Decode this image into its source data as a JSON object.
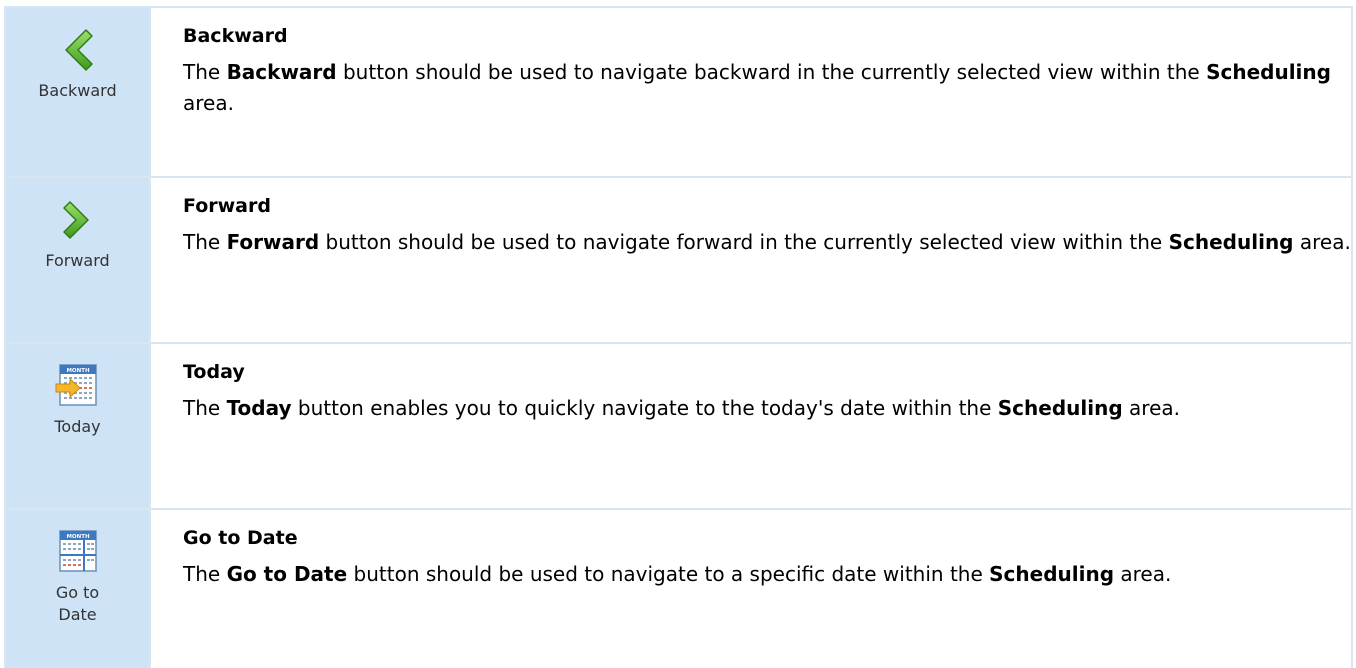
{
  "rows": [
    {
      "button_label": "Backward",
      "icon": "chevron-left-icon",
      "title": "Backward",
      "text_1": "The ",
      "bold_1": "Backward",
      "text_2": " button should be used to navigate backward in the currently selected view within the ",
      "bold_2": "Scheduling",
      "text_3": " area."
    },
    {
      "button_label": "Forward",
      "icon": "chevron-right-icon",
      "title": "Forward",
      "text_1": "The ",
      "bold_1": "Forward",
      "text_2": " button should be used to navigate forward in the currently selected view within the ",
      "bold_2": "Scheduling",
      "text_3": " area."
    },
    {
      "button_label": "Today",
      "icon": "calendar-today-icon",
      "calendar_header": "MONTH",
      "title": "Today",
      "text_1": "The ",
      "bold_1": "Today",
      "text_2": " button enables you to quickly navigate to the today's date within the ",
      "bold_2": "Scheduling",
      "text_3": " area."
    },
    {
      "button_label_line1": "Go to",
      "button_label_line2": "Date",
      "icon": "calendar-goto-icon",
      "calendar_header": "MONTH",
      "title": "Go to Date",
      "text_1": "The ",
      "bold_1": "Go to Date",
      "text_2": " button should be used to navigate to a specific date within the ",
      "bold_2": "Scheduling",
      "text_3": " area."
    }
  ],
  "colors": {
    "icon_column_bg": "#cfe3f7",
    "border": "#d9e6f2",
    "chevron_green": "#5cb531"
  }
}
